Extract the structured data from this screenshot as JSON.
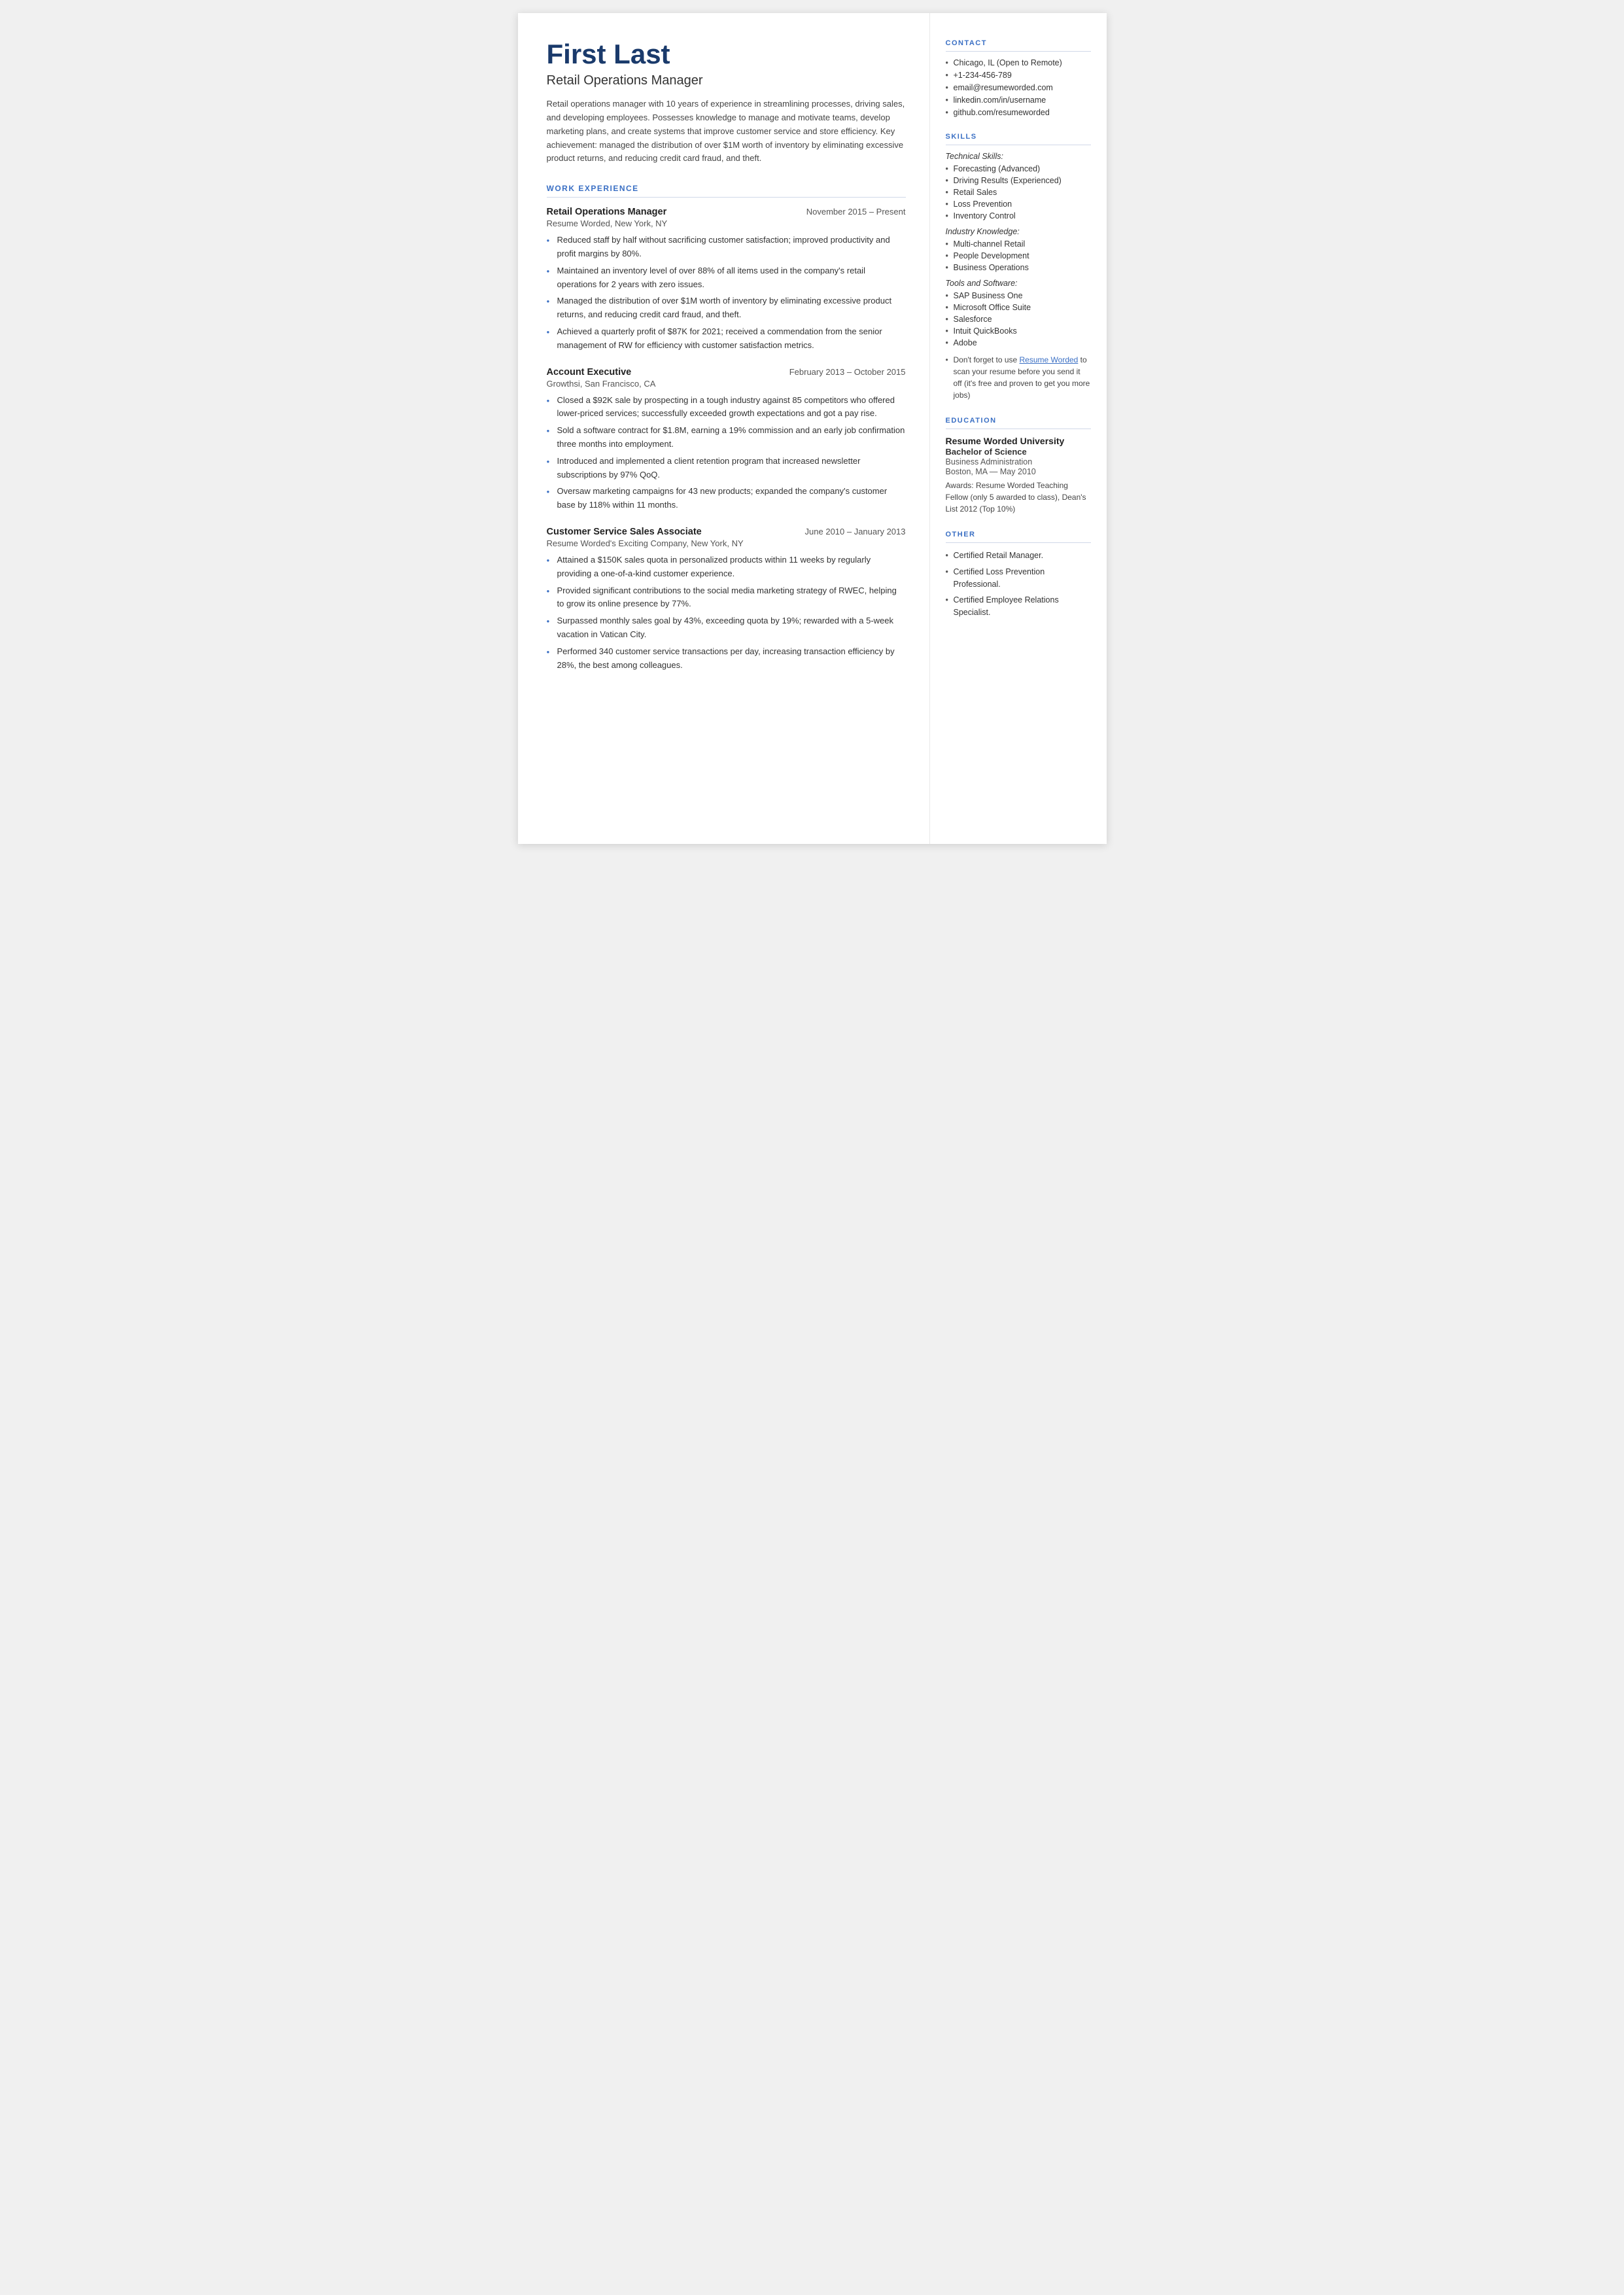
{
  "header": {
    "name": "First Last",
    "title": "Retail Operations Manager",
    "summary": "Retail operations manager with 10 years of experience in streamlining processes, driving sales, and developing employees. Possesses knowledge to manage and motivate teams, develop marketing plans, and create systems that improve customer service and store efficiency. Key achievement: managed the distribution of over $1M worth of inventory by eliminating excessive product returns, and reducing credit card fraud, and theft."
  },
  "work_experience_label": "WORK EXPERIENCE",
  "jobs": [
    {
      "title": "Retail Operations Manager",
      "dates": "November 2015 – Present",
      "company": "Resume Worded, New York, NY",
      "bullets": [
        "Reduced staff by half without sacrificing customer satisfaction; improved productivity and profit margins by 80%.",
        "Maintained an inventory level of over 88% of all items used in the company's retail operations for 2 years with zero issues.",
        "Managed the distribution of over $1M worth of inventory by eliminating excessive product returns, and reducing credit card fraud, and theft.",
        "Achieved a quarterly profit of $87K for 2021; received a commendation from the senior management of RW for efficiency with customer satisfaction metrics."
      ]
    },
    {
      "title": "Account Executive",
      "dates": "February 2013 – October 2015",
      "company": "Growthsi, San Francisco, CA",
      "bullets": [
        "Closed a $92K sale by prospecting in a tough industry against 85 competitors who offered lower-priced services; successfully exceeded growth expectations and got a pay rise.",
        "Sold a software contract for $1.8M, earning a 19% commission and an early job confirmation three months into employment.",
        "Introduced and implemented a client retention program that increased newsletter subscriptions by 97% QoQ.",
        "Oversaw marketing campaigns for 43 new products; expanded the company's customer base by 118% within 11 months."
      ]
    },
    {
      "title": "Customer Service Sales Associate",
      "dates": "June 2010 – January 2013",
      "company": "Resume Worded's Exciting Company, New York, NY",
      "bullets": [
        "Attained a $150K sales quota in personalized products within 11 weeks by regularly providing a one-of-a-kind customer experience.",
        "Provided significant contributions to the social media marketing strategy of RWEC, helping to grow its online presence by 77%.",
        "Surpassed monthly sales goal by 43%, exceeding quota by 19%; rewarded with a 5-week vacation in Vatican City.",
        "Performed 340 customer service transactions per day, increasing transaction efficiency by 28%, the best among colleagues."
      ]
    }
  ],
  "sidebar": {
    "contact_label": "CONTACT",
    "contact_items": [
      "Chicago, IL (Open to Remote)",
      "+1-234-456-789",
      "email@resumeworded.com",
      "linkedin.com/in/username",
      "github.com/resumeworded"
    ],
    "skills_label": "SKILLS",
    "skills_groups": [
      {
        "group_title": "Technical Skills:",
        "items": [
          "Forecasting (Advanced)",
          "Driving Results (Experienced)",
          "Retail Sales",
          "Loss Prevention",
          "Inventory Control"
        ]
      },
      {
        "group_title": "Industry Knowledge:",
        "items": [
          "Multi-channel Retail",
          "People Development",
          "Business Operations"
        ]
      },
      {
        "group_title": "Tools and Software:",
        "items": [
          "SAP Business One",
          "Microsoft Office Suite",
          "Salesforce",
          "Intuit QuickBooks",
          "Adobe"
        ]
      }
    ],
    "skills_note": "Don't forget to use Resume Worded to scan your resume before you send it off (it's free and proven to get you more jobs)",
    "education_label": "EDUCATION",
    "education": {
      "school": "Resume Worded University",
      "degree": "Bachelor of Science",
      "field": "Business Administration",
      "location_date": "Boston, MA — May 2010",
      "awards": "Awards: Resume Worded Teaching Fellow (only 5 awarded to class), Dean's List 2012 (Top 10%)"
    },
    "other_label": "OTHER",
    "other_items": [
      "Certified Retail Manager.",
      "Certified Loss Prevention Professional.",
      "Certified Employee Relations Specialist."
    ]
  }
}
